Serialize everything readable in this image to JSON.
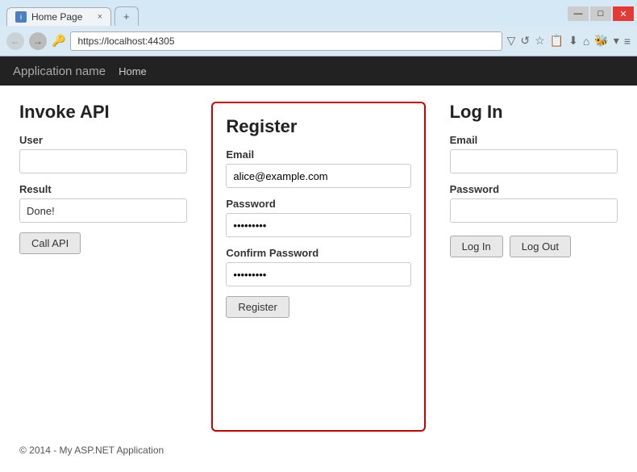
{
  "browser": {
    "tab_title": "Home Page",
    "tab_close": "×",
    "tab_new": "+",
    "address": "https://localhost:44305",
    "window_minimize": "—",
    "window_maximize": "□",
    "window_close": "✕"
  },
  "navbar": {
    "app_name": "Application name",
    "nav_home": "Home"
  },
  "invoke_api": {
    "title": "Invoke API",
    "user_label": "User",
    "user_placeholder": "",
    "result_label": "Result",
    "result_value": "Done!",
    "call_api_button": "Call API"
  },
  "register": {
    "title": "Register",
    "email_label": "Email",
    "email_value": "alice@example.com",
    "password_label": "Password",
    "password_value": "••••••••",
    "confirm_label": "Confirm Password",
    "confirm_value": "••••••••",
    "register_button": "Register"
  },
  "login": {
    "title": "Log In",
    "email_label": "Email",
    "email_placeholder": "",
    "password_label": "Password",
    "password_placeholder": "",
    "login_button": "Log In",
    "logout_button": "Log Out"
  },
  "footer": {
    "text": "© 2014 - My ASP.NET Application"
  }
}
